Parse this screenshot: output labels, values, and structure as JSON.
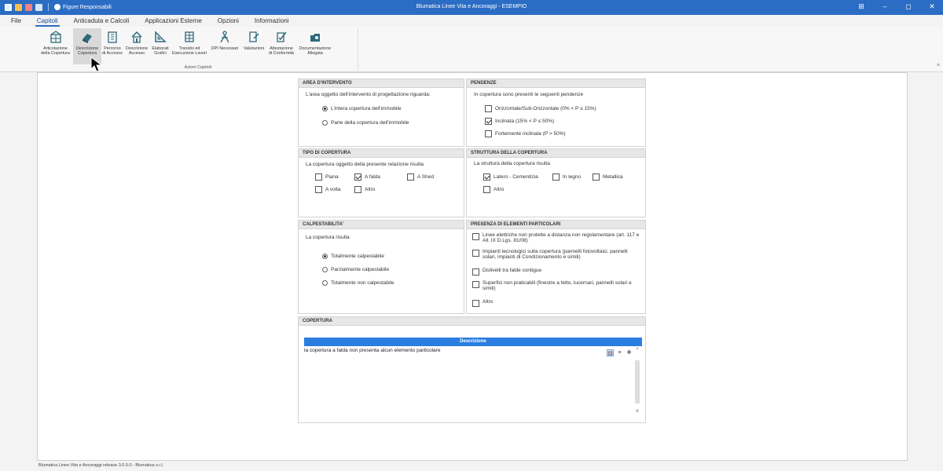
{
  "titlebar": {
    "user_label": "Figure Responsabili",
    "window_title": "Blumatica Linee Vita e Ancoraggi - ESEMPIO",
    "minimize": "–",
    "maximize": "◻",
    "close": "✕",
    "layout": "⊞"
  },
  "menu": {
    "items": [
      "File",
      "Capitoli",
      "Anticaduta e Calcoli",
      "Applicazioni Esterne",
      "Opzioni",
      "Informazioni"
    ]
  },
  "ribbon": {
    "group_label": "Azioni Capitoli",
    "tools": [
      {
        "label1": "Articolazione",
        "label2": "della Copertura"
      },
      {
        "label1": "Descrizione",
        "label2": "Copertura"
      },
      {
        "label1": "Percorso",
        "label2": "di Accesso"
      },
      {
        "label1": "Descrizione",
        "label2": "Accesso"
      },
      {
        "label1": "Elaborati",
        "label2": "Grafici"
      },
      {
        "label1": "Transito ed",
        "label2": "Esecuzione Lavori"
      },
      {
        "label1": "DPI Necessari",
        "label2": ""
      },
      {
        "label1": "Valutazioni",
        "label2": ""
      },
      {
        "label1": "Attestazione",
        "label2": "di Conformità"
      },
      {
        "label1": "Documentazione",
        "label2": "Allegata"
      }
    ]
  },
  "area_intervento": {
    "header": "AREA D'INTERVENTO",
    "question": "L'area oggetto dell'intervento di progettazione riguarda:",
    "options": [
      "L'intera copertura dell'immobile",
      "Parte della copertura dell'immobile"
    ],
    "selected": 0
  },
  "pendenze": {
    "header": "PENDENZE",
    "question": "In copertura sono presenti le seguenti pendenze",
    "options": [
      {
        "label": "Orizzontale/Sub-Orizzontale (0% < P ≤ 15%)",
        "checked": false
      },
      {
        "label": "Inclinata (15% < P ≤ 50%)",
        "checked": true
      },
      {
        "label": "Fortemente inclinata (P > 50%)",
        "checked": false
      }
    ]
  },
  "tipo_copertura": {
    "header": "TIPO DI COPERTURA",
    "question": "La copertura oggetto della presente relazione risulta",
    "options": [
      {
        "label": "Piana",
        "checked": false
      },
      {
        "label": "A falda",
        "checked": true
      },
      {
        "label": "A Shed",
        "checked": false
      },
      {
        "label": "A volta",
        "checked": false
      },
      {
        "label": "Altro",
        "checked": false
      }
    ]
  },
  "struttura": {
    "header": "STRUTTURA DELLA COPERTURA",
    "question": "La struttura della copertura risulta",
    "options": [
      {
        "label": "Latero - Cementizia",
        "checked": true
      },
      {
        "label": "In legno",
        "checked": false
      },
      {
        "label": "Metallica",
        "checked": false
      },
      {
        "label": "Altro",
        "checked": false
      }
    ]
  },
  "calpestabilita": {
    "header": "CALPESTABILITA'",
    "question": "La copertura risulta",
    "options": [
      "Totalmente calpestabile",
      "Parzialmente calpestabile",
      "Totalmente non calpestabile"
    ],
    "selected": 0
  },
  "elementi": {
    "header": "PRESENZA DI ELEMENTI PARTICOLARI",
    "options": [
      {
        "label": "Linee elettriche non protette a distanza non regolamentare (art. 117 e All. IX D.Lgs. 81/08)",
        "checked": false
      },
      {
        "label": "Impianti tecnologici sulla copertura (pannelli fotovoltaici, pannelli solari, impianti di Condizionamento e simili)",
        "checked": false
      },
      {
        "label": "Dislivelli tra falde contigue",
        "checked": false
      },
      {
        "label": "Superfici non praticabili (finestre a tetto, lucernari, pannelli solari e simili)",
        "checked": false
      },
      {
        "label": "Altro",
        "checked": false
      }
    ]
  },
  "copertura": {
    "header": "COPERTURA",
    "column_header": "Descrizione",
    "text": "la copertura a falda non presenta alcun elemento particolare"
  },
  "statusbar": {
    "text": "Blumatica Linee Vita e Ancoraggi release 3.0.0.0 - Blumatica s.r.l."
  },
  "colors": {
    "accent": "#2b6cc4",
    "header_bar": "#2b7de0"
  }
}
